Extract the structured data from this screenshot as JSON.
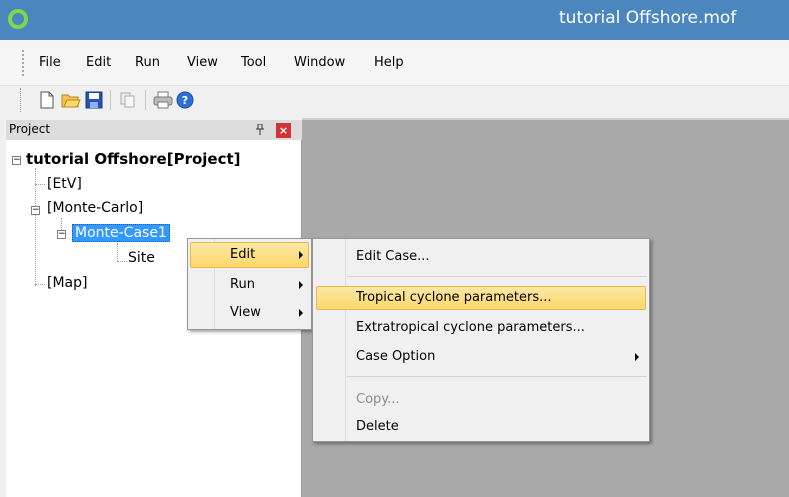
{
  "window": {
    "title": "tutorial Offshore.mof",
    "title_color": "#4b86bf"
  },
  "menubar": {
    "items": [
      "File",
      "Edit",
      "Run",
      "View",
      "Tool",
      "Window",
      "Help"
    ]
  },
  "toolbar": {
    "buttons": [
      "new-file-icon",
      "open-folder-icon",
      "save-icon",
      "copy-icon",
      "print-icon",
      "help-icon"
    ]
  },
  "project_panel": {
    "title": "Project",
    "pin": "⊥",
    "close": "×",
    "tree": {
      "root": "tutorial Offshore[Project]",
      "etv": "[EtV]",
      "monte_carlo": "[Monte-Carlo]",
      "monte_case": "Monte-Case1",
      "site": "Site",
      "map": "[Map]"
    }
  },
  "context_menu": {
    "items": [
      "Edit",
      "Run",
      "View"
    ],
    "highlighted": "Edit"
  },
  "submenu": {
    "edit_case": "Edit Case...",
    "tropical": "Tropical cyclone parameters...",
    "extratropical": "Extratropical cyclone parameters...",
    "case_option": "Case Option",
    "copy": "Copy...",
    "delete": "Delete",
    "highlighted": "Tropical cyclone parameters...",
    "highlight_color": "#fcd76a"
  }
}
